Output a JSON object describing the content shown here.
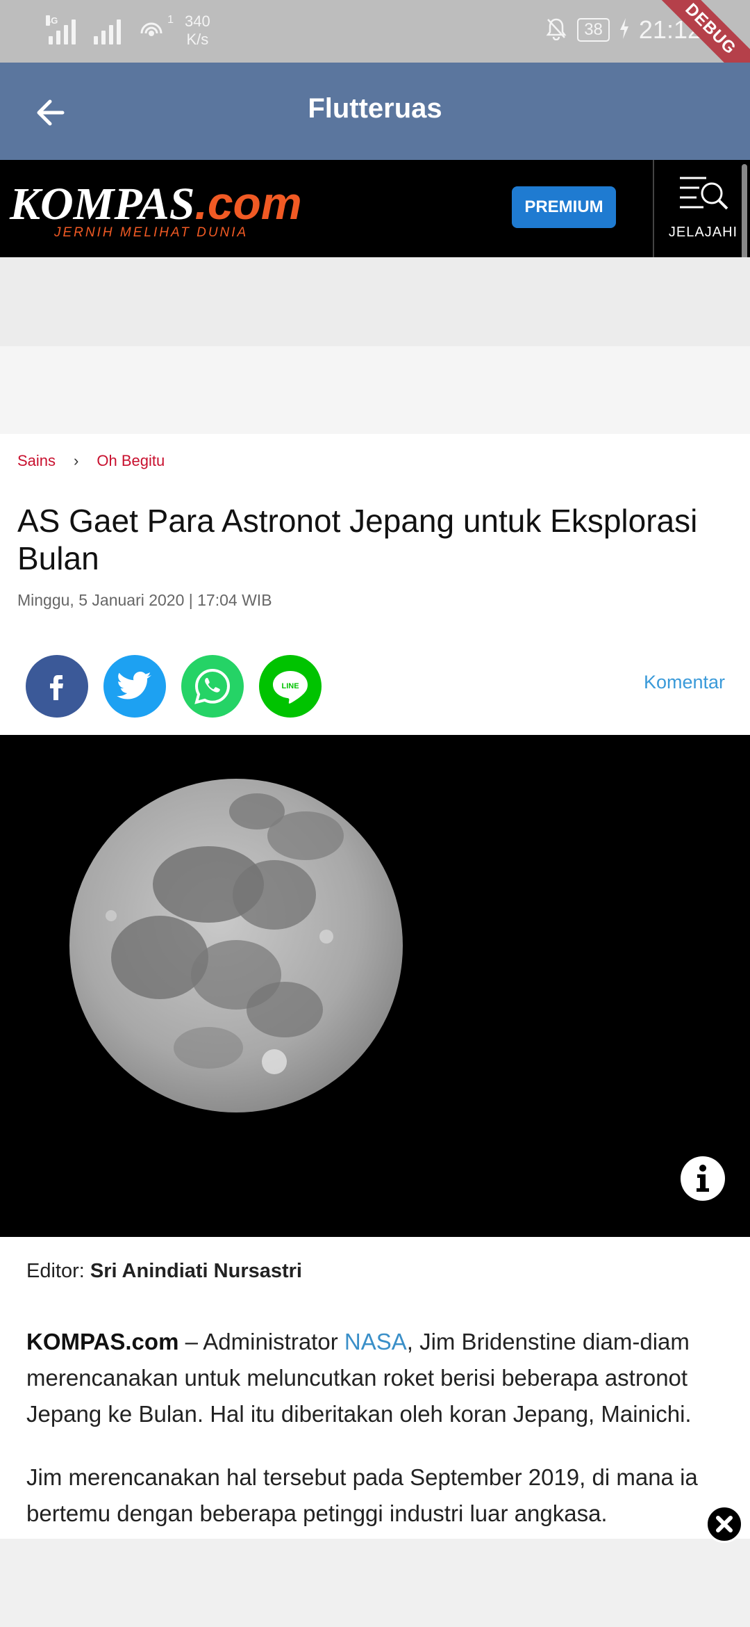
{
  "status_bar": {
    "net_type_tag": "4G",
    "wifi_badge": "1",
    "net_speed_value": "340",
    "net_speed_unit": "K/s",
    "battery": "38",
    "time": "21:12",
    "debug_label": "DEBUG"
  },
  "app_bar": {
    "title": "Flutteruas",
    "back_icon": "arrow-left-icon"
  },
  "kompas_header": {
    "logo_main": "KOMPAS",
    "logo_suffix": ".com",
    "tagline": "JERNIH MELIHAT DUNIA",
    "premium_label": "PREMIUM",
    "explore_label": "JELAJAHI",
    "explore_icon": "menu-search-icon"
  },
  "article": {
    "breadcrumb": [
      "Sains",
      "Oh Begitu"
    ],
    "breadcrumb_separator": "›",
    "title": "AS Gaet Para Astronot Jepang untuk Eksplorasi Bulan",
    "date": "Minggu, 5 Januari 2020 | 17:04 WIB",
    "comment_label": "Komentar",
    "share_icons": [
      "facebook-icon",
      "twitter-icon",
      "whatsapp-icon",
      "line-icon"
    ],
    "editor_label": "Editor:",
    "editor_name": "Sri Anindiati Nursastri",
    "paragraph1": {
      "lead": "KOMPAS.com",
      "dash": " – Administrator ",
      "link": "NASA",
      "rest": ", Jim Bridenstine diam-diam merencanakan untuk meluncutkan roket berisi beberapa astronot Jepang ke Bulan. Hal itu diberitakan oleh koran Jepang, Mainichi."
    },
    "paragraph2": "Jim merencanakan hal tersebut pada September 2019, di mana ia bertemu dengan beberapa petinggi industri luar angkasa."
  },
  "colors": {
    "app_bar": "#5b769e",
    "kompas_orange": "#f15a24",
    "premium_blue": "#1f7bd1",
    "breadcrumb_red": "#c8102e",
    "link_blue": "#3a8fc8"
  }
}
